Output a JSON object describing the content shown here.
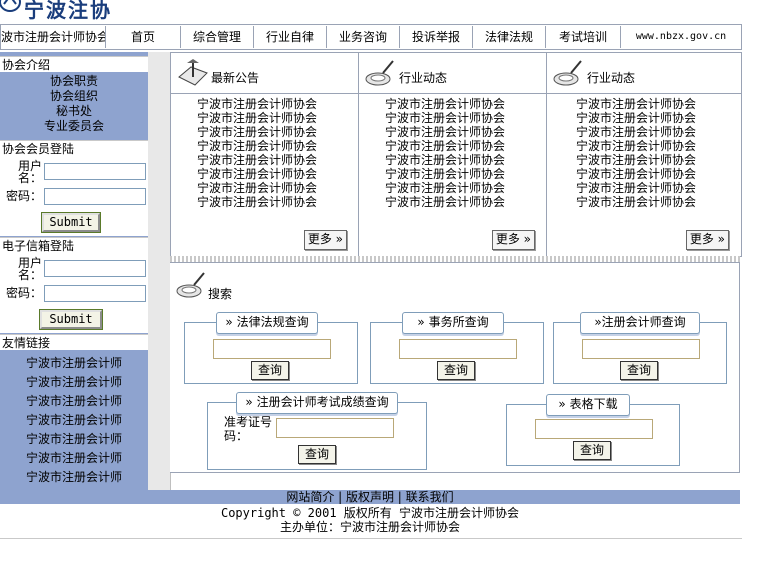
{
  "header": {
    "logo_text": "宁波注协"
  },
  "nav": {
    "items": [
      {
        "label": "波市注册会计师协会",
        "w": 104
      },
      {
        "label": "首页",
        "w": 74
      },
      {
        "label": "综合管理",
        "w": 72
      },
      {
        "label": "行业自律",
        "w": 72
      },
      {
        "label": "业务咨询",
        "w": 72
      },
      {
        "label": "投诉举报",
        "w": 72
      },
      {
        "label": "法律法规",
        "w": 72
      },
      {
        "label": "考试培训",
        "w": 74
      },
      {
        "label": "www.nbzx.gov.cn",
        "w": 120
      }
    ]
  },
  "sidebar": {
    "about": {
      "title": "协会介绍",
      "links": [
        "协会职责",
        "协会组织",
        "秘书处",
        "专业委员会"
      ]
    },
    "member_login": {
      "title": "协会会员登陆",
      "user_label": "用户名：",
      "password_label": "密码：",
      "submit_label": "Submit"
    },
    "mail_login": {
      "title": "电子信箱登陆",
      "user_label": "用户名：",
      "password_label": "密码：",
      "submit_label": "Submit"
    },
    "friends": {
      "title": "友情链接",
      "links": [
        "宁波市注册会计师",
        "宁波市注册会计师",
        "宁波市注册会计师",
        "宁波市注册会计师",
        "宁波市注册会计师",
        "宁波市注册会计师",
        "宁波市注册会计师"
      ]
    }
  },
  "panels": [
    {
      "title": "最新公告",
      "icon": "sign-icon",
      "items": [
        "宁波市注册会计师协会",
        "宁波市注册会计师协会",
        "宁波市注册会计师协会",
        "宁波市注册会计师协会",
        "宁波市注册会计师协会",
        "宁波市注册会计师协会",
        "宁波市注册会计师协会",
        "宁波市注册会计师协会"
      ],
      "more_label": "更多 »"
    },
    {
      "title": "行业动态",
      "icon": "magnifier-icon",
      "items": [
        "宁波市注册会计师协会",
        "宁波市注册会计师协会",
        "宁波市注册会计师协会",
        "宁波市注册会计师协会",
        "宁波市注册会计师协会",
        "宁波市注册会计师协会",
        "宁波市注册会计师协会",
        "宁波市注册会计师协会"
      ],
      "more_label": "更多 »"
    },
    {
      "title": "行业动态",
      "icon": "magnifier-icon",
      "items": [
        "宁波市注册会计师协会",
        "宁波市注册会计师协会",
        "宁波市注册会计师协会",
        "宁波市注册会计师协会",
        "宁波市注册会计师协会",
        "宁波市注册会计师协会",
        "宁波市注册会计师协会",
        "宁波市注册会计师协会"
      ],
      "more_label": "更多 »"
    }
  ],
  "search": {
    "title": "搜索",
    "law_query": {
      "title": "» 法律法规查询",
      "button": "查询"
    },
    "firm_query": {
      "title": "» 事务所查询",
      "button": "查询"
    },
    "cpa_query": {
      "title": "»注册会计师查询",
      "button": "查询"
    },
    "exam_query": {
      "title": "» 注册会计师考试成绩查询",
      "field_label": "准考证号码：",
      "button": "查询"
    },
    "form_download": {
      "title": "» 表格下载",
      "button": "查询"
    }
  },
  "footer": {
    "links": "网站简介 | 版权声明 | 联系我们",
    "copyright": "Copyright © 2001 版权所有 宁波市注册会计师协会",
    "host": "主办单位：宁波市注册会计师协会"
  }
}
